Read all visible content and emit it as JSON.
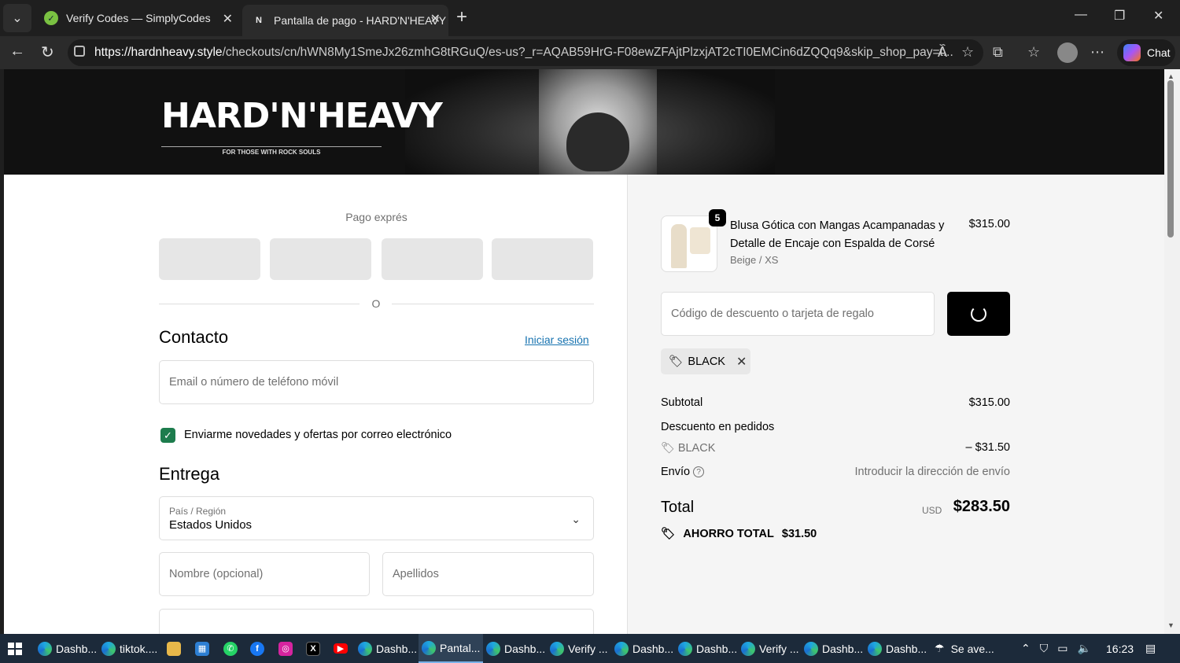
{
  "browser": {
    "tabs": [
      {
        "title": "Verify Codes — SimplyCodes",
        "icon": "simplycodes-icon"
      },
      {
        "title": "Pantalla de pago - HARD'N'HEAVY",
        "icon": "hardnheavy-icon",
        "active": true
      }
    ],
    "url_host": "https://hardnheavy.style",
    "url_rest": "/checkouts/cn/hWN8My1SmeJx26zmhG8tRGuQ/es-us?_r=AQAB59HrG-F08ewZFAjtPlzxjAT2cTI0EMCin6dZQQq9&skip_shop_pay=t...",
    "chat_label": "Chat"
  },
  "banner": {
    "logo_text": "HARD'N'HEAVY",
    "tagline": "FOR THOSE WITH ROCK SOULS"
  },
  "checkout": {
    "express_label": "Pago exprés",
    "or_label": "O",
    "contact": {
      "heading": "Contacto",
      "login_link": "Iniciar sesión",
      "email_placeholder": "Email o número de teléfono móvil",
      "newsletter_label": "Enviarme novedades y ofertas por correo electrónico",
      "newsletter_checked": true
    },
    "delivery": {
      "heading": "Entrega",
      "country_label": "País / Región",
      "country_value": "Estados Unidos",
      "first_name_placeholder": "Nombre (opcional)",
      "last_name_placeholder": "Apellidos"
    }
  },
  "summary": {
    "product": {
      "quantity": "5",
      "name": "Blusa Gótica con Mangas Acampanadas y Detalle de Encaje con Espalda de Corsé",
      "variant": "Beige / XS",
      "price": "$315.00"
    },
    "discount_placeholder": "Código de descuento o tarjeta de regalo",
    "applied_code": "BLACK",
    "subtotal_label": "Subtotal",
    "subtotal_value": "$315.00",
    "order_discount_label": "Descuento en pedidos",
    "discount_code": "BLACK",
    "discount_value": "– $31.50",
    "shipping_label": "Envío",
    "shipping_value": "Introducir la dirección de envío",
    "total_label": "Total",
    "currency": "USD",
    "total_value": "$283.50",
    "savings_label": "AHORRO TOTAL",
    "savings_value": "$31.50"
  },
  "taskbar": {
    "items": [
      "Dashb...",
      "tiktok....",
      "Dashb...",
      "Pantal...",
      "Dashb...",
      "Verify ...",
      "Dashb...",
      "Dashb...",
      "Verify ...",
      "Dashb...",
      "Dashb..."
    ],
    "weather": "Se ave...",
    "time": "16:23"
  },
  "colors": {
    "accent_green": "#1d7c4d",
    "link_blue": "#1773b0",
    "summary_bg": "#f5f5f5"
  }
}
